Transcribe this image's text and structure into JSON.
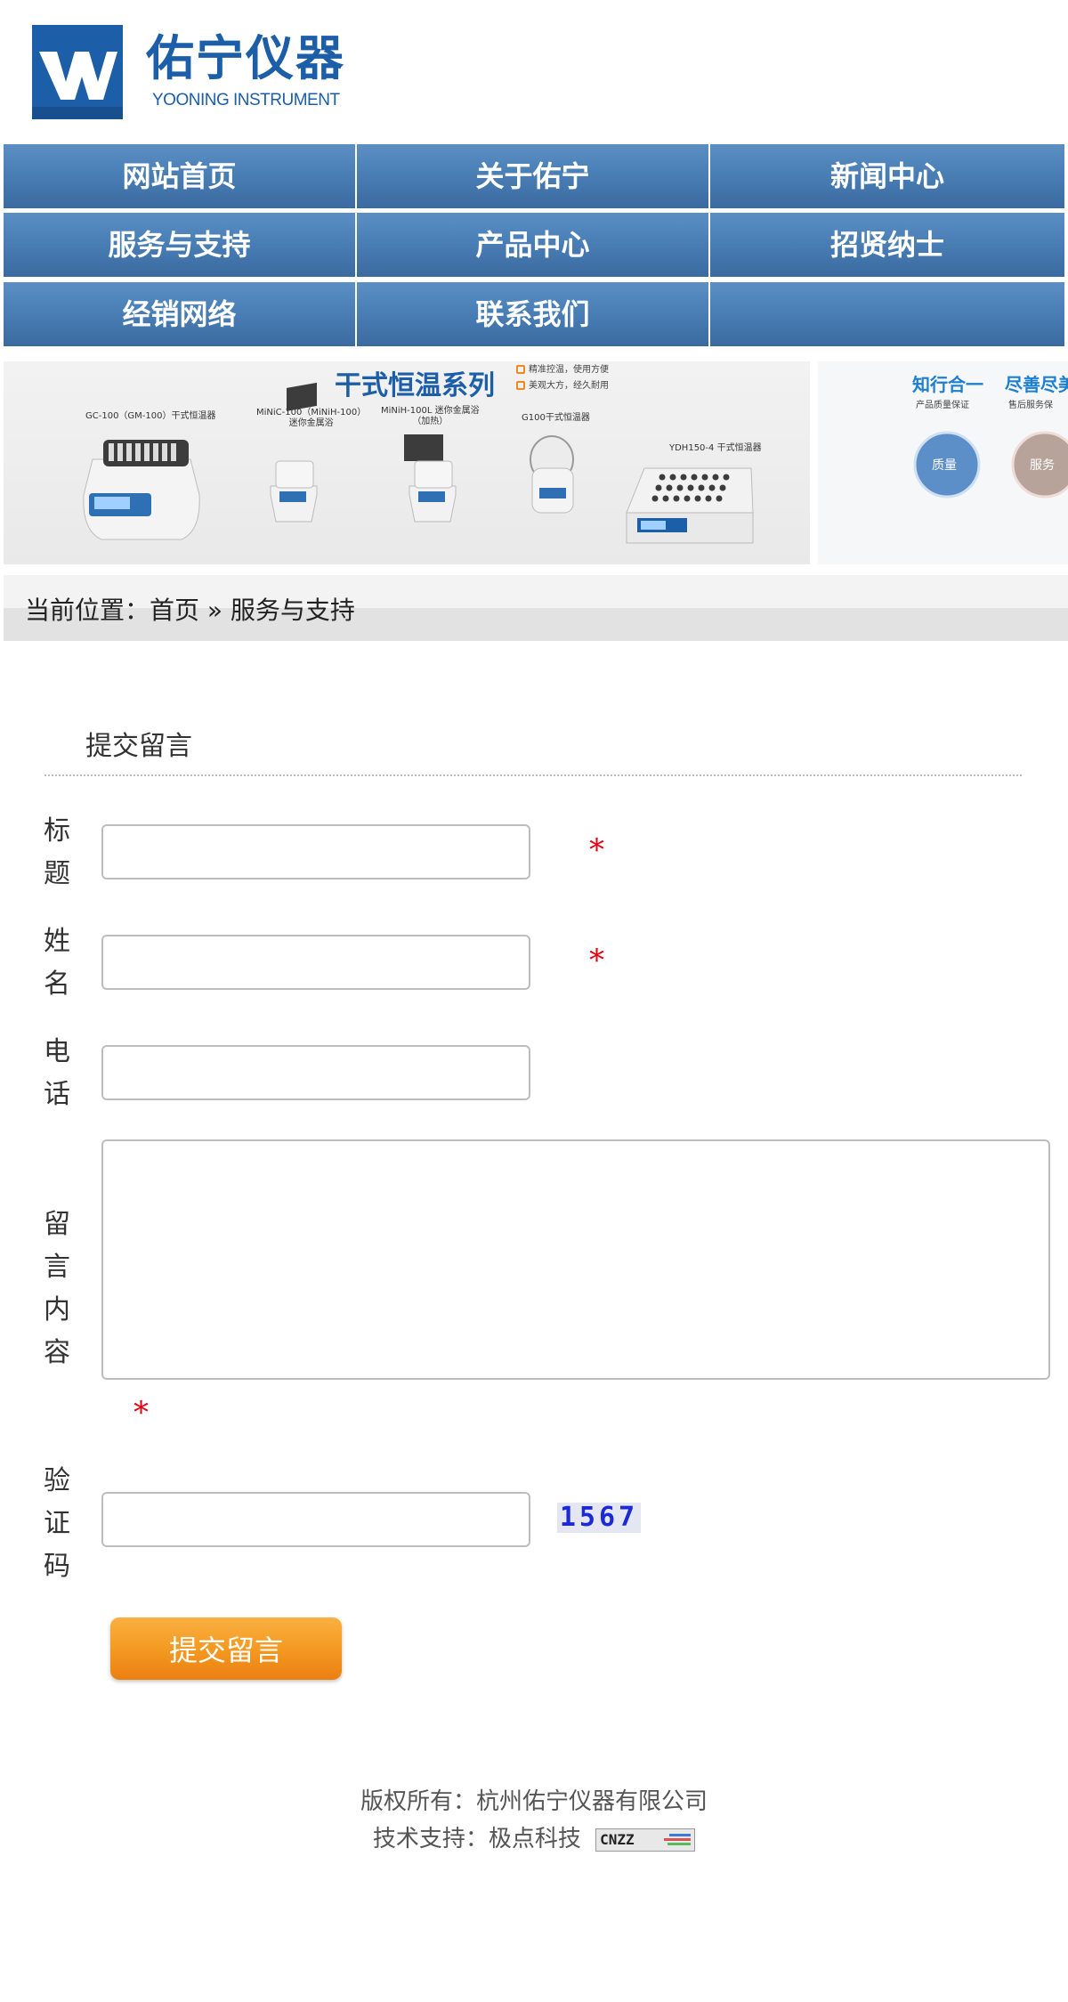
{
  "logo": {
    "name": "佑宁仪器",
    "subtitle": "YOONING INSTRUMENT",
    "colors": {
      "brand": "#1d5ea8"
    }
  },
  "nav": {
    "items": [
      {
        "label": "网站首页"
      },
      {
        "label": "关于佑宁"
      },
      {
        "label": "新闻中心"
      },
      {
        "label": "服务与支持"
      },
      {
        "label": "产品中心"
      },
      {
        "label": "招贤纳士"
      },
      {
        "label": "经销网络"
      },
      {
        "label": "联系我们"
      }
    ]
  },
  "banner": {
    "title": "干式恒温系列",
    "features": [
      "精准控温，使用方便",
      "美观大方，经久耐用"
    ],
    "products": [
      {
        "label": "GC-100（GM-100）干式恒温器"
      },
      {
        "label": "MiNiC-100（MiNiH-100）\n迷你金属浴"
      },
      {
        "label": "MiNiH-100L 迷你金属浴\n（加热）"
      },
      {
        "label": "G100干式恒温器"
      },
      {
        "label": "YDH150-4 干式恒温器"
      }
    ],
    "side": {
      "heading1": "知行合一",
      "heading2": "尽善尽美",
      "sub1": "产品质量保证",
      "sub2": "售后服务保",
      "badge1": "质量",
      "badge2": "服务"
    }
  },
  "breadcrumb": {
    "text": "当前位置：首页 » 服务与支持"
  },
  "form": {
    "title": "提交留言",
    "fields": {
      "title_label": "标题",
      "name_label": "姓名",
      "phone_label": "电话",
      "content_label": "留言内容",
      "captcha_label": "验证码"
    },
    "required_mark": "*",
    "captcha_code": "1567",
    "submit_label": "提交留言"
  },
  "footer": {
    "copyright": "版权所有：杭州佑宁仪器有限公司",
    "support": "技术支持：极点科技",
    "stats_badge": "CNZZ"
  }
}
